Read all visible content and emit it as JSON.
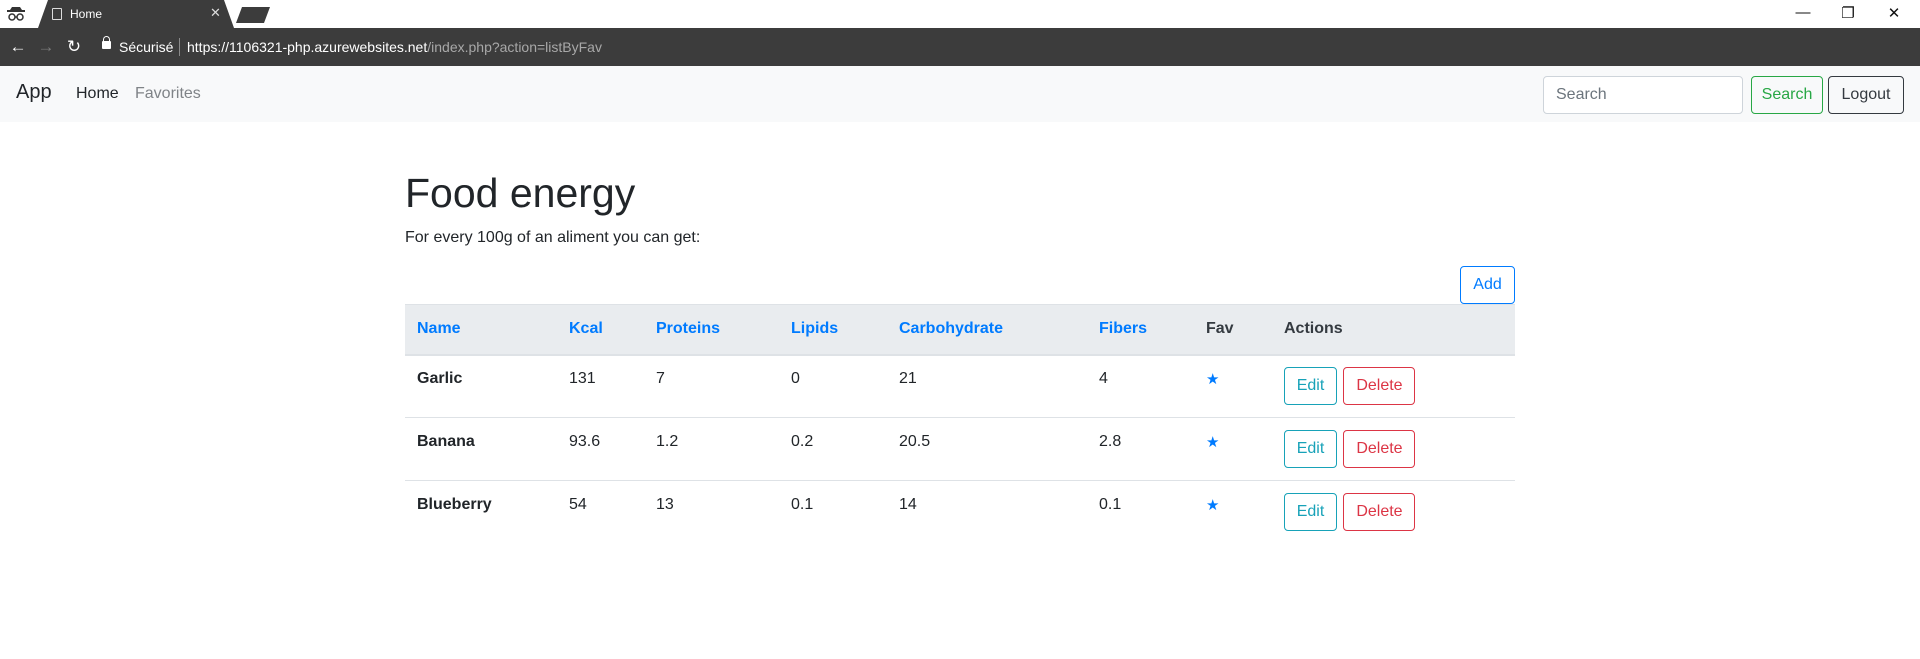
{
  "browser": {
    "tab_title": "Home",
    "secure_label": "Sécurisé",
    "url_host": "https://1106321-php.azurewebsites.net",
    "url_path": "/index.php?action=listByFav"
  },
  "navbar": {
    "brand": "App",
    "links": {
      "home": "Home",
      "favorites": "Favorites"
    },
    "search_placeholder": "Search",
    "search_button": "Search",
    "logout_button": "Logout"
  },
  "main": {
    "title": "Food energy",
    "subtitle": "For every 100g of an aliment you can get:",
    "add_button": "Add"
  },
  "table": {
    "headers": [
      "Name",
      "Kcal",
      "Proteins",
      "Lipids",
      "Carbohydrate",
      "Fibers",
      "Fav",
      "Actions"
    ],
    "rows": [
      {
        "name": "Garlic",
        "kcal": "131",
        "proteins": "7",
        "lipids": "0",
        "carbohydrate": "21",
        "fibers": "4",
        "fav": "★",
        "edit": "Edit",
        "delete": "Delete"
      },
      {
        "name": "Banana",
        "kcal": "93.6",
        "proteins": "1.2",
        "lipids": "0.2",
        "carbohydrate": "20.5",
        "fibers": "2.8",
        "fav": "★",
        "edit": "Edit",
        "delete": "Delete"
      },
      {
        "name": "Blueberry",
        "kcal": "54",
        "proteins": "13",
        "lipids": "0.1",
        "carbohydrate": "14",
        "fibers": "0.1",
        "fav": "★",
        "edit": "Edit",
        "delete": "Delete"
      }
    ]
  },
  "colors": {
    "primary": "#007bff",
    "success": "#28a745",
    "info": "#17a2b8",
    "danger": "#dc3545",
    "dark": "#343a40",
    "navbar_bg": "#f8f9fa",
    "table_head_bg": "#e9ecef",
    "browser_chrome": "#3c3c3c"
  },
  "icons": {
    "incognito": "incognito-icon",
    "page": "page-icon",
    "close_tab": "close-icon",
    "minimize": "minimize-icon",
    "restore": "restore-icon",
    "close_window": "close-icon",
    "back": "back-arrow-icon",
    "forward": "forward-arrow-icon",
    "reload": "reload-icon",
    "lock": "lock-icon",
    "bookmark": "star-icon",
    "menu": "kebab-menu-icon",
    "favorite": "star-icon"
  }
}
